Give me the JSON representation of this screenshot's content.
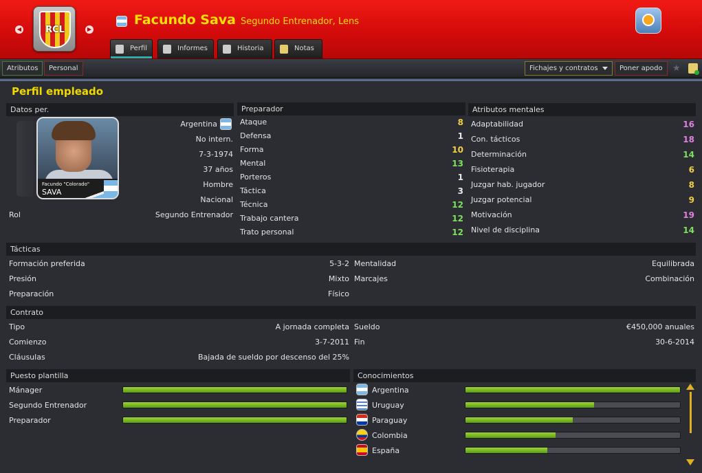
{
  "header": {
    "name": "Facundo Sava",
    "role": "Segundo Entrenador, Lens",
    "club_badge_text": "RCL"
  },
  "tabs": [
    {
      "label": "Perfil",
      "active": true
    },
    {
      "label": "Informes"
    },
    {
      "label": "Historia"
    },
    {
      "label": "Notas"
    }
  ],
  "subnav": {
    "atributos": "Atributos",
    "personal": "Personal",
    "fichajes": "Fichajes y contratos",
    "apodo": "Poner apodo"
  },
  "page_title": "Perfil empleado",
  "datos": {
    "title": "Datos per.",
    "rows": [
      "Argentina",
      "No intern.",
      "7-3-1974",
      "37 años",
      "Hombre",
      "Nacional"
    ],
    "rol_label": "Rol",
    "rol_value": "Segundo Entrenador",
    "photo_caption_1": "Facundo \"Colorado\"",
    "photo_caption_2": "SAVA"
  },
  "preparador": {
    "title": "Preparador",
    "rows": [
      {
        "label": "Ataque",
        "value": "8",
        "color": "#f0d040"
      },
      {
        "label": "Defensa",
        "value": "1",
        "color": "#e8e8e8"
      },
      {
        "label": "Forma",
        "value": "10",
        "color": "#f0d040"
      },
      {
        "label": "Mental",
        "value": "13",
        "color": "#7fe060"
      },
      {
        "label": "Porteros",
        "value": "1",
        "color": "#e8e8e8"
      },
      {
        "label": "Táctica",
        "value": "3",
        "color": "#e8e8e8"
      },
      {
        "label": "Técnica",
        "value": "12",
        "color": "#7fe060"
      },
      {
        "label": "Trabajo cantera",
        "value": "12",
        "color": "#7fe060"
      },
      {
        "label": "Trato personal",
        "value": "12",
        "color": "#7fe060"
      }
    ]
  },
  "mentales": {
    "title": "Atributos mentales",
    "rows": [
      {
        "label": "Adaptabilidad",
        "value": "16",
        "color": "#e080e0"
      },
      {
        "label": "Con. tácticos",
        "value": "18",
        "color": "#e080e0"
      },
      {
        "label": "Determinación",
        "value": "14",
        "color": "#7fe060"
      },
      {
        "label": "Fisioterapia",
        "value": "6",
        "color": "#f0d040"
      },
      {
        "label": "Juzgar hab. jugador",
        "value": "8",
        "color": "#f0d040"
      },
      {
        "label": "Juzgar potencial",
        "value": "9",
        "color": "#f0d040"
      },
      {
        "label": "Motivación",
        "value": "19",
        "color": "#e080e0"
      },
      {
        "label": "Nivel de disciplina",
        "value": "14",
        "color": "#7fe060"
      }
    ]
  },
  "tacticas": {
    "title": "Tácticas",
    "left": [
      {
        "label": "Formación preferida",
        "value": "5-3-2"
      },
      {
        "label": "Presión",
        "value": "Mixto"
      },
      {
        "label": "Preparación",
        "value": "Físico"
      }
    ],
    "right": [
      {
        "label": "Mentalidad",
        "value": "Equilibrada"
      },
      {
        "label": "Marcajes",
        "value": "Combinación"
      }
    ]
  },
  "contrato": {
    "title": "Contrato",
    "left": [
      {
        "label": "Tipo",
        "value": "A jornada completa"
      },
      {
        "label": "Comienzo",
        "value": "3-7-2011"
      },
      {
        "label": "Cláusulas",
        "value": "Bajada de sueldo por descenso del 25%"
      }
    ],
    "right": [
      {
        "label": "Sueldo",
        "value": "€450,000 anuales"
      },
      {
        "label": "Fin",
        "value": "30-6-2014"
      }
    ]
  },
  "puesto": {
    "title": "Puesto plantilla",
    "rows": [
      {
        "label": "Mánager",
        "level": 1.0
      },
      {
        "label": "Segundo Entrenador",
        "level": 1.0
      },
      {
        "label": "Preparador",
        "level": 1.0
      }
    ]
  },
  "conocimientos": {
    "title": "Conocimientos",
    "rows": [
      {
        "label": "Argentina",
        "level": 1.0,
        "flag": "argentina-flag-icon"
      },
      {
        "label": "Uruguay",
        "level": 0.6,
        "flag": "uruguay-flag-icon"
      },
      {
        "label": "Paraguay",
        "level": 0.5,
        "flag": "paraguay-flag-icon"
      },
      {
        "label": "Colombia",
        "level": 0.42,
        "flag": "colombia-flag-icon"
      },
      {
        "label": "España",
        "level": 0.38,
        "flag": "spain-flag-icon"
      }
    ]
  }
}
